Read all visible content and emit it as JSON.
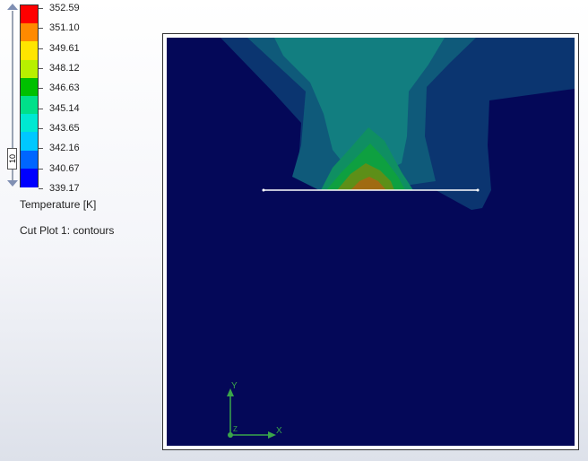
{
  "legend": {
    "values": [
      "352.59",
      "351.10",
      "349.61",
      "348.12",
      "346.63",
      "345.14",
      "343.65",
      "342.16",
      "340.67",
      "339.17"
    ],
    "band_colors": [
      "#ff0000",
      "#ff8a00",
      "#ffe500",
      "#b8f000",
      "#00c000",
      "#00e08a",
      "#00e8d2",
      "#00c8ff",
      "#0066ff",
      "#0000ff"
    ],
    "slider_value": "10",
    "title": "Temperature [K]"
  },
  "caption": "Cut Plot 1: contours",
  "viewport": {
    "background_color": "#040858",
    "contour_colors": {
      "outer": "#0b3570",
      "mid": "#0f5a7a",
      "teal": "#127e80",
      "green1": "#0f8f62",
      "green2": "#0ea040",
      "olive": "#5d8f18",
      "hot": "#a06b12"
    },
    "triad_labels": {
      "x": "X",
      "y": "Y",
      "z": "Z"
    }
  }
}
